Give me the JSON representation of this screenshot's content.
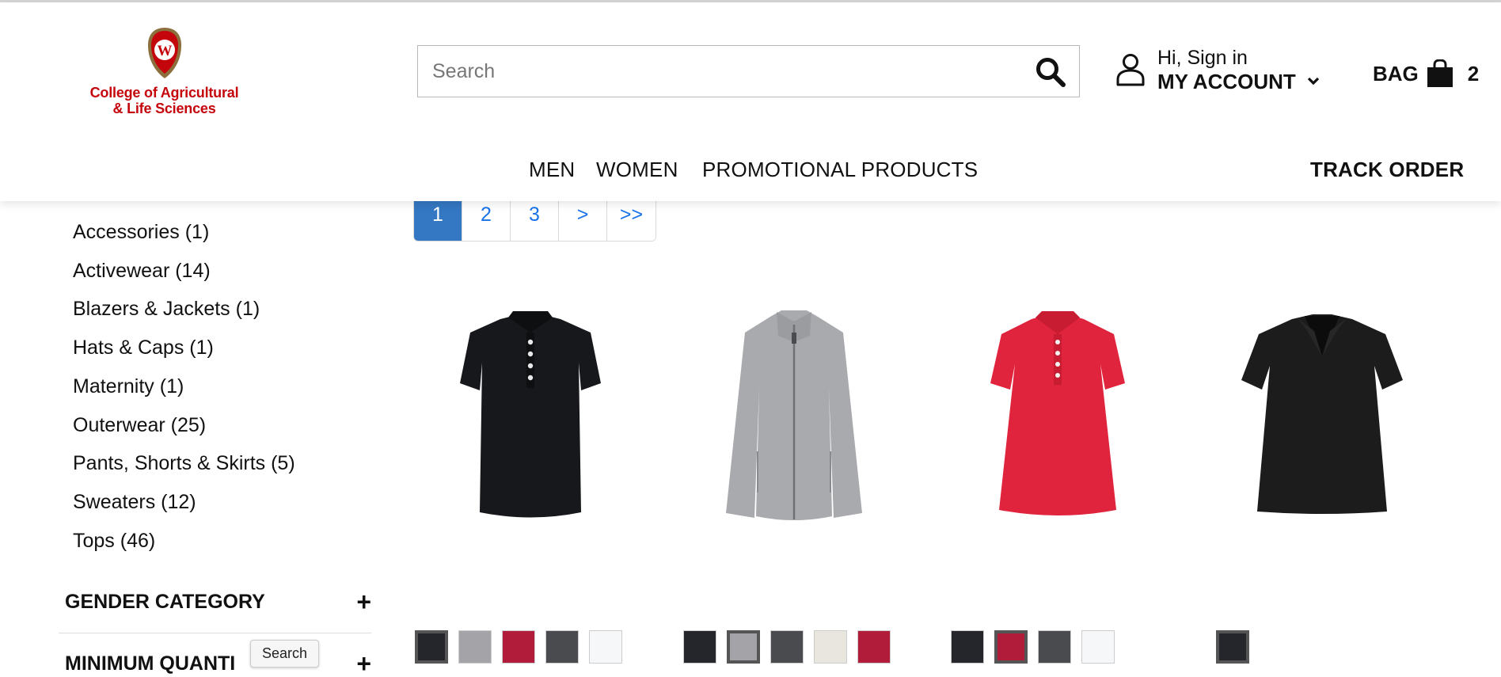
{
  "header": {
    "logo": {
      "brand_line1": "College of Agricultural",
      "brand_line2": "& Life Sciences",
      "crest_letter": "W"
    },
    "search": {
      "placeholder": "Search"
    },
    "account": {
      "greeting": "Hi, Sign in",
      "label": "MY ACCOUNT"
    },
    "bag": {
      "label": "BAG",
      "count": "2"
    },
    "nav": {
      "men": "MEN",
      "women": "WOMEN",
      "promotional": "PROMOTIONAL PRODUCTS",
      "track_order": "TRACK ORDER"
    }
  },
  "sidebar": {
    "categories": [
      {
        "label": "Accessories (1)"
      },
      {
        "label": "Activewear (14)"
      },
      {
        "label": "Blazers & Jackets (1)"
      },
      {
        "label": "Hats & Caps (1)"
      },
      {
        "label": "Maternity (1)"
      },
      {
        "label": "Outerwear (25)"
      },
      {
        "label": "Pants, Shorts & Skirts (5)"
      },
      {
        "label": "Sweaters (12)"
      },
      {
        "label": "Tops (46)"
      }
    ],
    "facets": [
      {
        "label": "GENDER CATEGORY",
        "toggle": "+"
      },
      {
        "label": "MINIMUM QUANTI",
        "toggle": "+"
      }
    ],
    "tooltip": "Search"
  },
  "pagination": {
    "pages": [
      "1",
      "2",
      "3",
      ">",
      ">>"
    ],
    "current": "1"
  },
  "products": [
    {
      "image": "black-polo-shirt",
      "swatches": [
        {
          "color": "#24262b",
          "selected": true
        },
        {
          "color": "#a4a4a8",
          "selected": false
        },
        {
          "color": "#b01c3a",
          "selected": false
        },
        {
          "color": "#4a4b4f",
          "selected": false
        },
        {
          "color": "#f6f7f9",
          "selected": false
        }
      ]
    },
    {
      "image": "gray-fleece-jacket",
      "swatches": [
        {
          "color": "#24262b",
          "selected": false
        },
        {
          "color": "#a4a4a8",
          "selected": true
        },
        {
          "color": "#4a4b4f",
          "selected": false
        },
        {
          "color": "#e9e6df",
          "selected": false
        },
        {
          "color": "#b01c3a",
          "selected": false
        }
      ]
    },
    {
      "image": "red-polo-shirt",
      "swatches": [
        {
          "color": "#24262b",
          "selected": false
        },
        {
          "color": "#b01c3a",
          "selected": true
        },
        {
          "color": "#4a4b4f",
          "selected": false
        },
        {
          "color": "#f6f7f9",
          "selected": false
        }
      ]
    },
    {
      "image": "black-vneck-polo",
      "swatches": [
        {
          "color": "#24262b",
          "selected": true
        }
      ]
    }
  ],
  "colors": {
    "brand_red": "#c5050c",
    "pager_active": "#3477c2",
    "link_blue": "#1a73e8"
  }
}
